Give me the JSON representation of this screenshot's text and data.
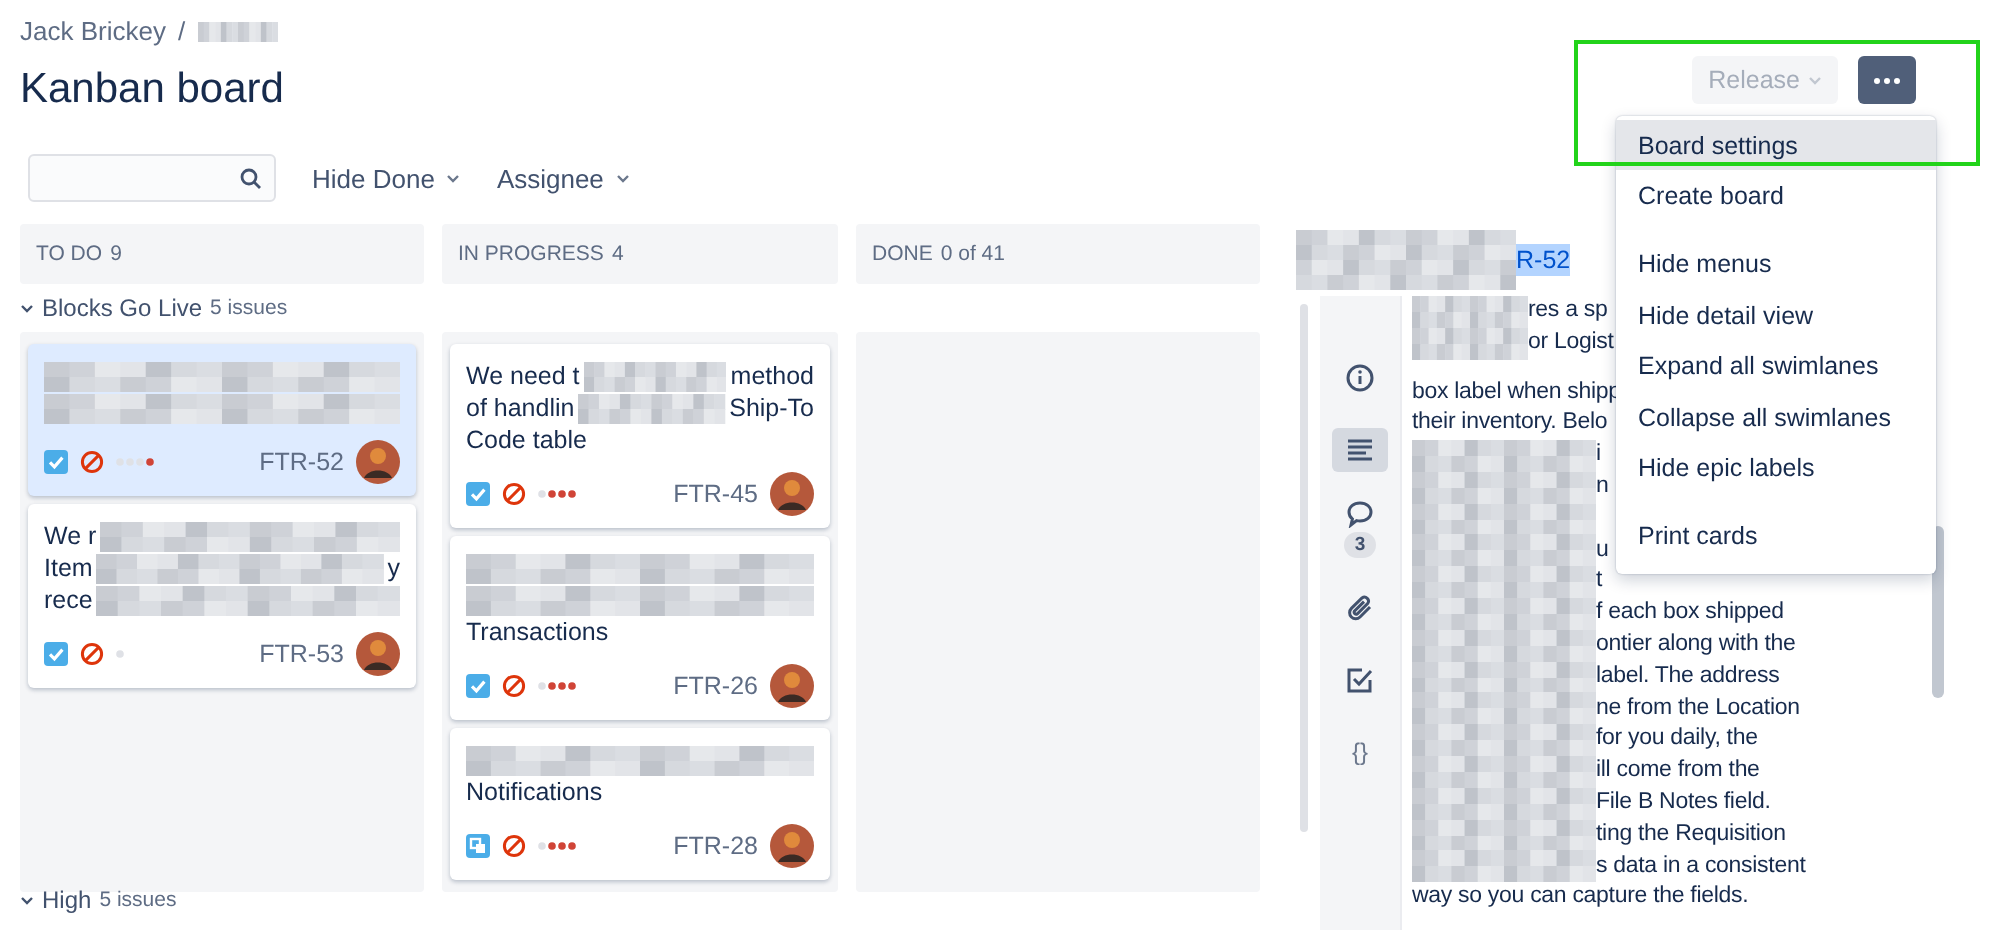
{
  "breadcrumb": {
    "owner": "Jack Brickey",
    "separator": "/"
  },
  "title": "Kanban board",
  "toolbar": {
    "filters": [
      {
        "label": "Hide Done"
      },
      {
        "label": "Assignee"
      }
    ],
    "release": {
      "label": "Release",
      "disabled": true
    }
  },
  "menu": {
    "groups": [
      [
        {
          "label": "Board settings",
          "selected": true
        },
        {
          "label": "Create board",
          "selected": false
        }
      ],
      [
        {
          "label": "Hide menus",
          "selected": false
        },
        {
          "label": "Hide detail view",
          "selected": false
        },
        {
          "label": "Expand all swimlanes",
          "selected": false
        },
        {
          "label": "Collapse all swimlanes",
          "selected": false
        },
        {
          "label": "Hide epic labels",
          "selected": false
        }
      ],
      [
        {
          "label": "Print cards",
          "selected": false
        }
      ]
    ]
  },
  "columns": [
    {
      "name": "TO DO",
      "count": "9"
    },
    {
      "name": "IN PROGRESS",
      "count": "4"
    },
    {
      "name": "DONE",
      "count": "0 of 41"
    }
  ],
  "swimlanes": [
    {
      "name": "Blocks Go Live",
      "count": "5 issues",
      "cells": [
        [
          {
            "key": "FTR-52",
            "kind": "task",
            "selected": true,
            "priority_dots": [
              {
                "color": "#dfe1e6"
              },
              {
                "color": "#dfe1e6"
              },
              {
                "color": "#dfe1e6"
              },
              {
                "color": "#d04437"
              }
            ],
            "lines": [
              [
                {
                  "kind": "blur"
                }
              ],
              [
                {
                  "kind": "blur"
                }
              ]
            ]
          },
          {
            "key": "FTR-53",
            "kind": "task",
            "selected": false,
            "priority_dots": [
              {
                "color": "#dfe1e6"
              }
            ],
            "lines": [
              [
                {
                  "kind": "text",
                  "text": "We r"
                },
                {
                  "kind": "blur"
                }
              ],
              [
                {
                  "kind": "text",
                  "text": "Item"
                },
                {
                  "kind": "blur"
                },
                {
                  "kind": "text",
                  "text": "y"
                }
              ],
              [
                {
                  "kind": "text",
                  "text": "rece"
                },
                {
                  "kind": "blur"
                }
              ]
            ]
          }
        ],
        [
          {
            "key": "FTR-45",
            "kind": "task",
            "selected": false,
            "priority_dots": [
              {
                "color": "#dfe1e6"
              },
              {
                "color": "#d04437"
              },
              {
                "color": "#d04437"
              },
              {
                "color": "#d04437"
              }
            ],
            "lines": [
              [
                {
                  "kind": "text",
                  "text": "We need t"
                },
                {
                  "kind": "blur"
                },
                {
                  "kind": "text",
                  "text": "method"
                }
              ],
              [
                {
                  "kind": "text",
                  "text": "of handlin"
                },
                {
                  "kind": "blur"
                },
                {
                  "kind": "text",
                  "text": "Ship-To"
                }
              ],
              [
                {
                  "kind": "text",
                  "text": "Code table"
                }
              ]
            ]
          },
          {
            "key": "FTR-26",
            "kind": "task",
            "selected": false,
            "priority_dots": [
              {
                "color": "#dfe1e6"
              },
              {
                "color": "#d04437"
              },
              {
                "color": "#d04437"
              },
              {
                "color": "#d04437"
              }
            ],
            "lines": [
              [
                {
                  "kind": "blur"
                }
              ],
              [
                {
                  "kind": "blur"
                }
              ],
              [
                {
                  "kind": "text",
                  "text": "Transactions"
                }
              ]
            ]
          },
          {
            "key": "FTR-28",
            "kind": "subtask",
            "selected": false,
            "priority_dots": [
              {
                "color": "#dfe1e6"
              },
              {
                "color": "#d04437"
              },
              {
                "color": "#d04437"
              },
              {
                "color": "#d04437"
              }
            ],
            "lines": [
              [
                {
                  "kind": "blur"
                }
              ],
              [
                {
                  "kind": "text",
                  "text": "Notifications"
                }
              ]
            ]
          }
        ],
        []
      ]
    },
    {
      "name": "High",
      "count": "5 issues"
    }
  ],
  "detail": {
    "key_fragment": "R-52",
    "side_tabs": [
      {
        "kind": "info",
        "selected": false
      },
      {
        "kind": "description",
        "selected": true
      },
      {
        "kind": "comments",
        "selected": false,
        "badge": "3"
      },
      {
        "kind": "attachments",
        "selected": false
      },
      {
        "kind": "checklist",
        "selected": false
      },
      {
        "kind": "code",
        "selected": false,
        "glyph": "{}"
      }
    ],
    "description": [
      [
        {
          "kind": "short_blur"
        },
        {
          "kind": "text",
          "text": "res a sp"
        }
      ],
      [
        {
          "kind": "short_blur"
        },
        {
          "kind": "text",
          "text": "or Logist"
        }
      ],
      [
        {
          "kind": "gap"
        }
      ],
      [
        {
          "kind": "text",
          "text": "box label when shipp"
        }
      ],
      [
        {
          "kind": "text",
          "text": "their inventory. Belo"
        }
      ],
      [
        {
          "kind": "blur"
        },
        {
          "kind": "text",
          "text": "i"
        }
      ],
      [
        {
          "kind": "blur"
        },
        {
          "kind": "text",
          "text": "n"
        }
      ],
      [
        {
          "kind": "blur"
        }
      ],
      [
        {
          "kind": "blur"
        },
        {
          "kind": "text",
          "text": "u"
        }
      ],
      [
        {
          "kind": "blur"
        },
        {
          "kind": "text",
          "text": "t"
        }
      ],
      [
        {
          "kind": "blur"
        },
        {
          "kind": "text",
          "text": "f each box shipped"
        }
      ],
      [
        {
          "kind": "blur"
        },
        {
          "kind": "text",
          "text": "ontier along with the"
        }
      ],
      [
        {
          "kind": "blur"
        },
        {
          "kind": "text",
          "text": "label. The address"
        }
      ],
      [
        {
          "kind": "blur"
        },
        {
          "kind": "text",
          "text": "ne from the Location"
        }
      ],
      [
        {
          "kind": "blur"
        },
        {
          "kind": "text",
          "text": "for you daily, the"
        }
      ],
      [
        {
          "kind": "blur"
        },
        {
          "kind": "text",
          "text": "ill come from the"
        }
      ],
      [
        {
          "kind": "blur"
        },
        {
          "kind": "text",
          "text": "File B Notes field."
        }
      ],
      [
        {
          "kind": "blur"
        },
        {
          "kind": "text",
          "text": "ting the Requisition"
        }
      ],
      [
        {
          "kind": "blur"
        },
        {
          "kind": "text",
          "text": "s data in a consistent"
        }
      ],
      [
        {
          "kind": "text",
          "text": "way so you can capture the fields."
        }
      ]
    ]
  }
}
